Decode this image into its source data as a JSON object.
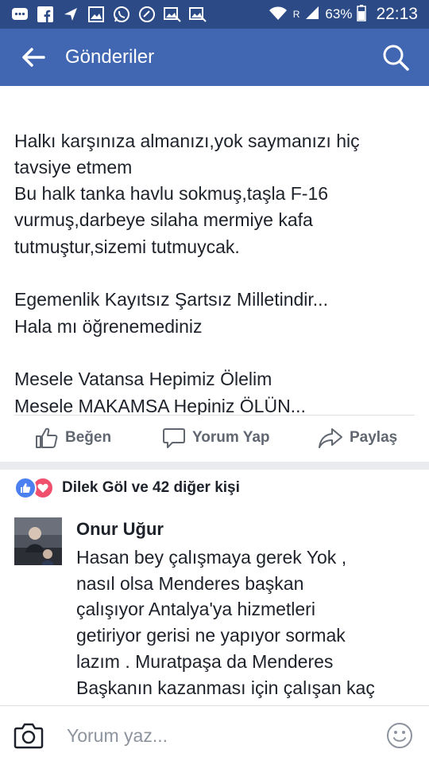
{
  "status_bar": {
    "icons": [
      "messenger-icon",
      "facebook-icon",
      "send-icon",
      "gallery-icon",
      "whatsapp-icon",
      "chat-icon",
      "image-notification-icon",
      "image-notification-icon",
      "wifi-icon",
      "signal-icon"
    ],
    "network_label": "R",
    "battery": "63%",
    "time": "22:13"
  },
  "app_bar": {
    "title": "Gönderiler"
  },
  "post": {
    "lines": [
      "Halkı karşınıza almanızı,yok saymanızı hiç",
      "tavsiye etmem",
      "Bu halk tanka havlu sokmuş,taşla F-16",
      "vurmuş,darbeye silaha mermiye kafa",
      "tutmuştur,sizemi tutmuycak.",
      "Egemenlik Kayıtsız Şartsız Milletindir...",
      "Hala mı öğrenemediniz",
      "Mesele Vatansa Hepimiz Ölelim",
      "Mesele MAKAMSA Hepiniz ÖLÜN..."
    ]
  },
  "actions": {
    "like": "Beğen",
    "comment": "Yorum Yap",
    "share": "Paylaş"
  },
  "reactions": {
    "summary": "Dilek Göl ve 42 diğer kişi"
  },
  "comment": {
    "author": "Onur Uğur",
    "lines": [
      "Hasan bey çalışmaya gerek Yok ,",
      "nasıl olsa Menderes başkan",
      "çalışıyor Antalya'ya hizmetleri",
      "getiriyor gerisi ne yapıyor sormak",
      "lazım . Muratpaşa da Menderes",
      "Başkanın kazanması için çalışan kaç"
    ]
  },
  "composer": {
    "placeholder": "Yorum yaz..."
  }
}
